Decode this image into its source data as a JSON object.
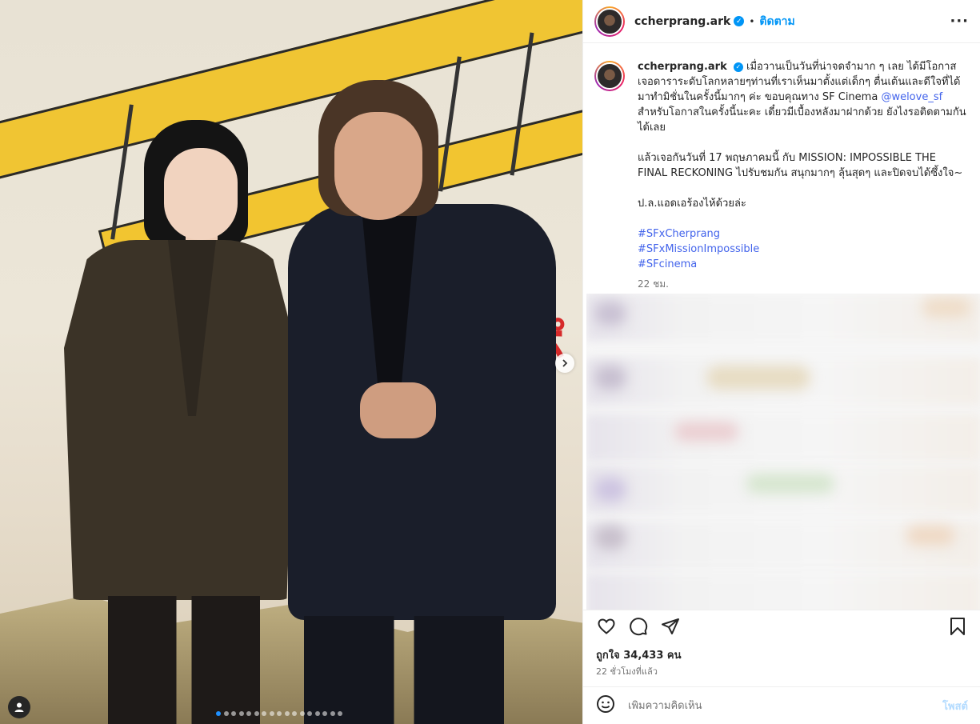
{
  "post": {
    "username": "ccherprang.ark",
    "separator": "•",
    "follow_label": "ติดตาม",
    "more_label": "···"
  },
  "caption": {
    "username": "ccherprang.ark",
    "text_line1": "เมื่อวานเป็นวันที่น่าจดจำมาก ๆ เลย ได้มีโอกาสเจอดาราระดับโลกหลายๆท่านที่เราเห็นมาตั้งแต่เด็กๆ ตื่นเต้นและดีใจที่ได้มาทำมิชั่นในครั้งนี้มากๆ ค่ะ ขอบคุณทาง SF Cinema ",
    "mention": "@welove_sf",
    "text_line1_end": " สำหรับโอกาสในครั้งนี้นะคะ เดี๋ยวมีเบื้องหลังมาฝากด้วย ยังไงรอติดตามกันได้เลย",
    "paragraph2": "แล้วเจอกันวันที่ 17 พฤษภาคมนี้ กับ MISSION: IMPOSSIBLE THE FINAL RECKONING ไปรับชมกัน สนุกมากๆ ลุ้นสุดๆ และปิดจบได้ซึ้งใจ~",
    "paragraph3": "ป.ล.แอดเอร้องไห้ด้วยล่ะ",
    "hashtags": [
      "#SFxCherprang",
      "#SFxMissionImpossible",
      "#SFcinema"
    ],
    "time": "22 ชม."
  },
  "actions": {
    "like_icon": "heart-icon",
    "comment_icon": "comment-icon",
    "share_icon": "send-icon",
    "save_icon": "bookmark-icon"
  },
  "likes": "ถูกใจ 34,433 คน",
  "post_time": "22 ชั่วโมงที่แล้ว",
  "comment": {
    "placeholder": "เพิ่มความคิดเห็น",
    "post_label": "โพสต์",
    "emoji_icon": "emoji-icon"
  },
  "carousel": {
    "total_slides": 17,
    "active_index": 0,
    "next_icon": "chevron-right-icon"
  },
  "colors": {
    "accent": "#0095f6",
    "post_disabled": "#b3dbff",
    "link": "#4263eb"
  }
}
